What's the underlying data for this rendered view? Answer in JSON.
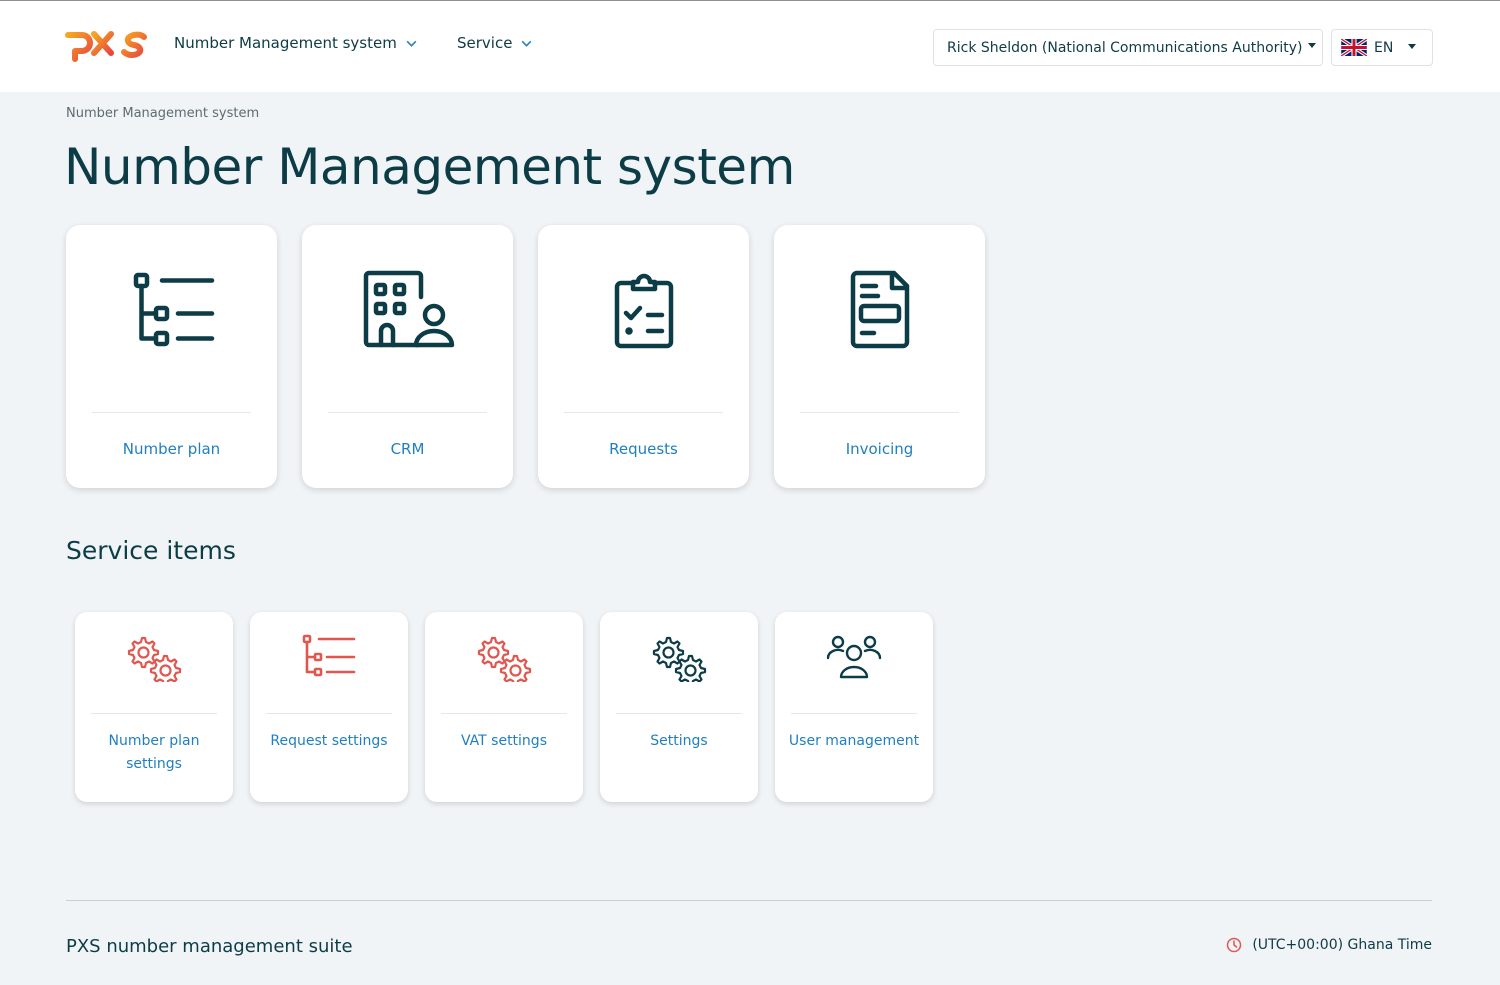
{
  "header": {
    "logo_text": "PXS",
    "nav": [
      {
        "label": "Number Management system"
      },
      {
        "label": "Service"
      }
    ],
    "user_label": "Rick Sheldon (National Communications Authority)",
    "language": "EN",
    "language_flag": "uk-flag-icon"
  },
  "breadcrumb": "Number Management system",
  "page_title": "Number Management system",
  "cards": [
    {
      "label": "Number plan",
      "icon": "tree-list-icon"
    },
    {
      "label": "CRM",
      "icon": "building-person-icon"
    },
    {
      "label": "Requests",
      "icon": "clipboard-check-icon"
    },
    {
      "label": "Invoicing",
      "icon": "invoice-document-icon"
    }
  ],
  "service_section_title": "Service items",
  "service_items": [
    {
      "label": "Number plan settings",
      "icon": "gears-icon"
    },
    {
      "label": "Request settings",
      "icon": "tree-list-icon"
    },
    {
      "label": "VAT settings",
      "icon": "gears-icon"
    },
    {
      "label": "Settings",
      "icon": "gears-icon"
    },
    {
      "label": "User management",
      "icon": "users-icon"
    }
  ],
  "footer": {
    "title": "PXS number management suite",
    "timezone": "(UTC+00:00) Ghana Time"
  },
  "colors": {
    "primary_dark": "#0c3c46",
    "link_blue": "#1f7fc0",
    "accent_red": "#e0574f",
    "background": "#f1f4f7"
  }
}
